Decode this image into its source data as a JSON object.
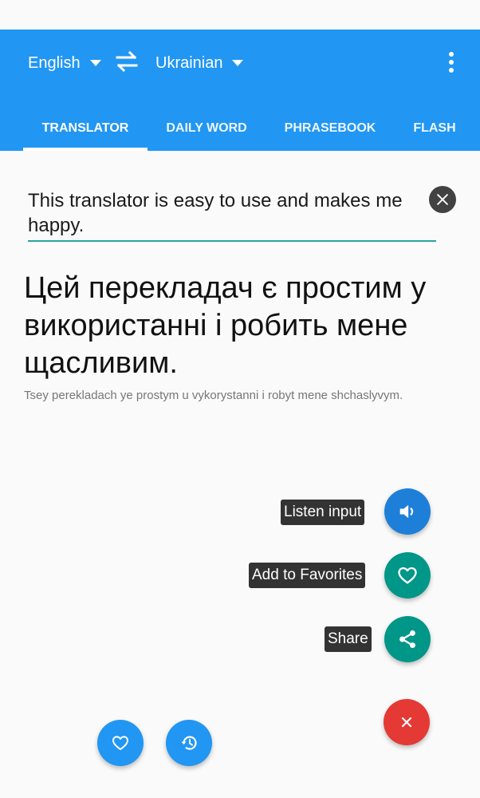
{
  "header": {
    "source_language": "English",
    "target_language": "Ukrainian"
  },
  "tabs": [
    {
      "label": "TRANSLATOR",
      "active": true
    },
    {
      "label": "DAILY WORD",
      "active": false
    },
    {
      "label": "PHRASEBOOK",
      "active": false
    },
    {
      "label": "FLASH",
      "active": false
    }
  ],
  "translator": {
    "input_text": "This translator is easy to use and makes me happy.",
    "output_text": "Цей перекладач є простим у використанні і робить мене щасливим.",
    "transliteration": "Tsey perekladach ye prostym u vykorystanni i robyt  mene shchaslyvym."
  },
  "speed_dial": {
    "listen_label": "Listen input",
    "favorites_label": "Add to Favorites",
    "share_label": "Share"
  },
  "icons": {
    "swap": "swap-horiz-icon",
    "menu": "more-vert-icon",
    "clear": "close-circle-icon",
    "listen": "volume-icon",
    "favorite": "heart-outline-icon",
    "share": "share-icon",
    "close": "close-icon",
    "history": "history-icon"
  },
  "colors": {
    "primary": "#2196f3",
    "teal": "#26a69a",
    "fab_teal": "#009688",
    "fab_blue": "#1e7fd8",
    "fab_close": "#e53935",
    "label_bg": "#333333"
  }
}
